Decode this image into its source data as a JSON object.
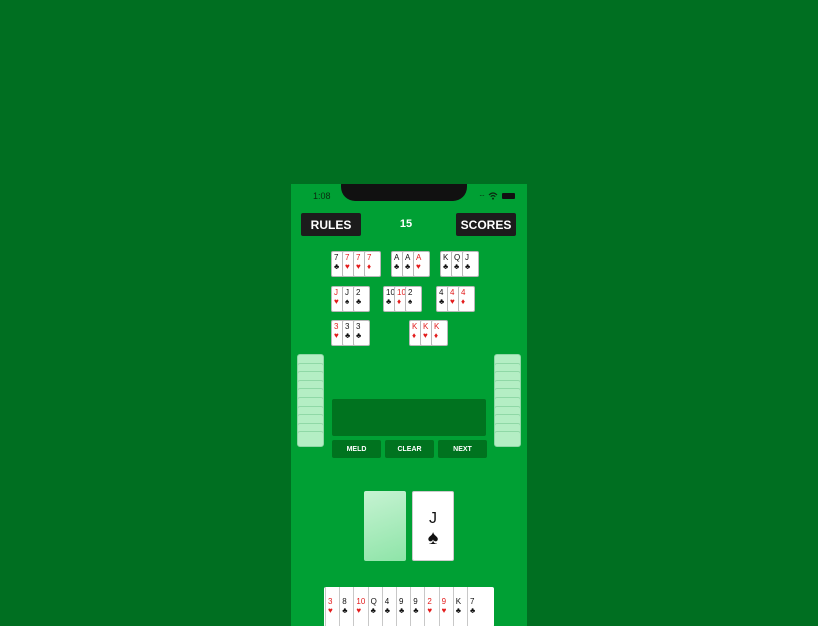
{
  "status": {
    "time": "1:08",
    "signal": "···"
  },
  "header": {
    "rules_label": "RULES",
    "score": "15",
    "scores_label": "SCORES"
  },
  "melds": [
    {
      "cards": [
        {
          "rank": "7",
          "suit": "♣",
          "color": "black"
        },
        {
          "rank": "7",
          "suit": "♥",
          "color": "red"
        },
        {
          "rank": "7",
          "suit": "♥",
          "color": "red"
        },
        {
          "rank": "7",
          "suit": "♦",
          "color": "red"
        }
      ]
    },
    {
      "cards": [
        {
          "rank": "A",
          "suit": "♣",
          "color": "black"
        },
        {
          "rank": "A",
          "suit": "♣",
          "color": "black"
        },
        {
          "rank": "A",
          "suit": "♥",
          "color": "red"
        }
      ]
    },
    {
      "cards": [
        {
          "rank": "K",
          "suit": "♣",
          "color": "black"
        },
        {
          "rank": "Q",
          "suit": "♣",
          "color": "black"
        },
        {
          "rank": "J",
          "suit": "♣",
          "color": "black"
        }
      ]
    },
    {
      "cards": [
        {
          "rank": "J",
          "suit": "♥",
          "color": "red"
        },
        {
          "rank": "J",
          "suit": "♠",
          "color": "black"
        },
        {
          "rank": "2",
          "suit": "♣",
          "color": "black"
        }
      ]
    },
    {
      "cards": [
        {
          "rank": "10",
          "suit": "♣",
          "color": "black"
        },
        {
          "rank": "10",
          "suit": "♦",
          "color": "red"
        },
        {
          "rank": "2",
          "suit": "♠",
          "color": "black"
        }
      ]
    },
    {
      "cards": [
        {
          "rank": "4",
          "suit": "♣",
          "color": "black"
        },
        {
          "rank": "4",
          "suit": "♥",
          "color": "red"
        },
        {
          "rank": "4",
          "suit": "♦",
          "color": "red"
        }
      ]
    },
    {
      "cards": [
        {
          "rank": "3",
          "suit": "♥",
          "color": "red"
        },
        {
          "rank": "3",
          "suit": "♣",
          "color": "black"
        },
        {
          "rank": "3",
          "suit": "♣",
          "color": "black"
        }
      ]
    },
    {
      "cards": [
        {
          "rank": "K",
          "suit": "♦",
          "color": "red"
        },
        {
          "rank": "K",
          "suit": "♥",
          "color": "red"
        },
        {
          "rank": "K",
          "suit": "♦",
          "color": "red"
        }
      ]
    }
  ],
  "actions": {
    "meld_label": "MELD",
    "clear_label": "CLEAR",
    "next_label": "NEXT"
  },
  "discard_top": {
    "rank": "J",
    "suit": "♠",
    "color": "black"
  },
  "hand": [
    {
      "rank": "3",
      "suit": "♥",
      "color": "red"
    },
    {
      "rank": "8",
      "suit": "♣",
      "color": "black"
    },
    {
      "rank": "10",
      "suit": "♥",
      "color": "red"
    },
    {
      "rank": "Q",
      "suit": "♣",
      "color": "black"
    },
    {
      "rank": "4",
      "suit": "♣",
      "color": "black"
    },
    {
      "rank": "9",
      "suit": "♣",
      "color": "black"
    },
    {
      "rank": "9",
      "suit": "♣",
      "color": "black"
    },
    {
      "rank": "2",
      "suit": "♥",
      "color": "red"
    },
    {
      "rank": "9",
      "suit": "♥",
      "color": "red"
    },
    {
      "rank": "K",
      "suit": "♣",
      "color": "black"
    },
    {
      "rank": "7",
      "suit": "♣",
      "color": "black"
    }
  ],
  "colors": {
    "table": "#006f21",
    "felt": "#00a034",
    "panel": "#00731f",
    "button": "#1c1c1c"
  }
}
